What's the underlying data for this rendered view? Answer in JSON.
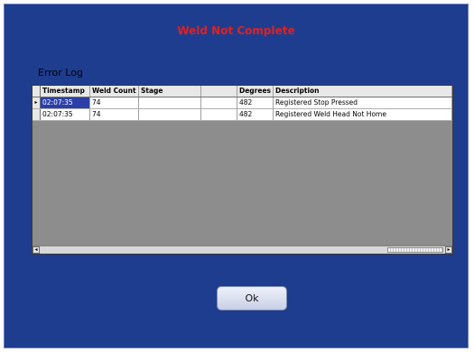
{
  "dialog": {
    "title": "Weld Not Complete",
    "error_log_label": "Error Log",
    "ok_label": "Ok"
  },
  "grid": {
    "columns": [
      "Timestamp",
      "Weld Count",
      "Stage",
      "",
      "Degrees",
      "Description"
    ],
    "rows": [
      {
        "timestamp": "02:07:35",
        "weld_count": "74",
        "stage": "",
        "blank": "",
        "degrees": "482",
        "description": "Registered Stop Pressed"
      },
      {
        "timestamp": "02:07:35",
        "weld_count": "74",
        "stage": "",
        "blank": "",
        "degrees": "482",
        "description": "Registered Weld Head Not Home"
      }
    ],
    "selected_row": 0,
    "current_row_marker": "▸"
  },
  "colors": {
    "background": "#1f3d8e",
    "title": "#e02020",
    "selection": "#2b3fa8"
  },
  "icons": [
    "scroll-left-arrow-icon",
    "scroll-right-arrow-icon",
    "current-row-marker-icon"
  ]
}
